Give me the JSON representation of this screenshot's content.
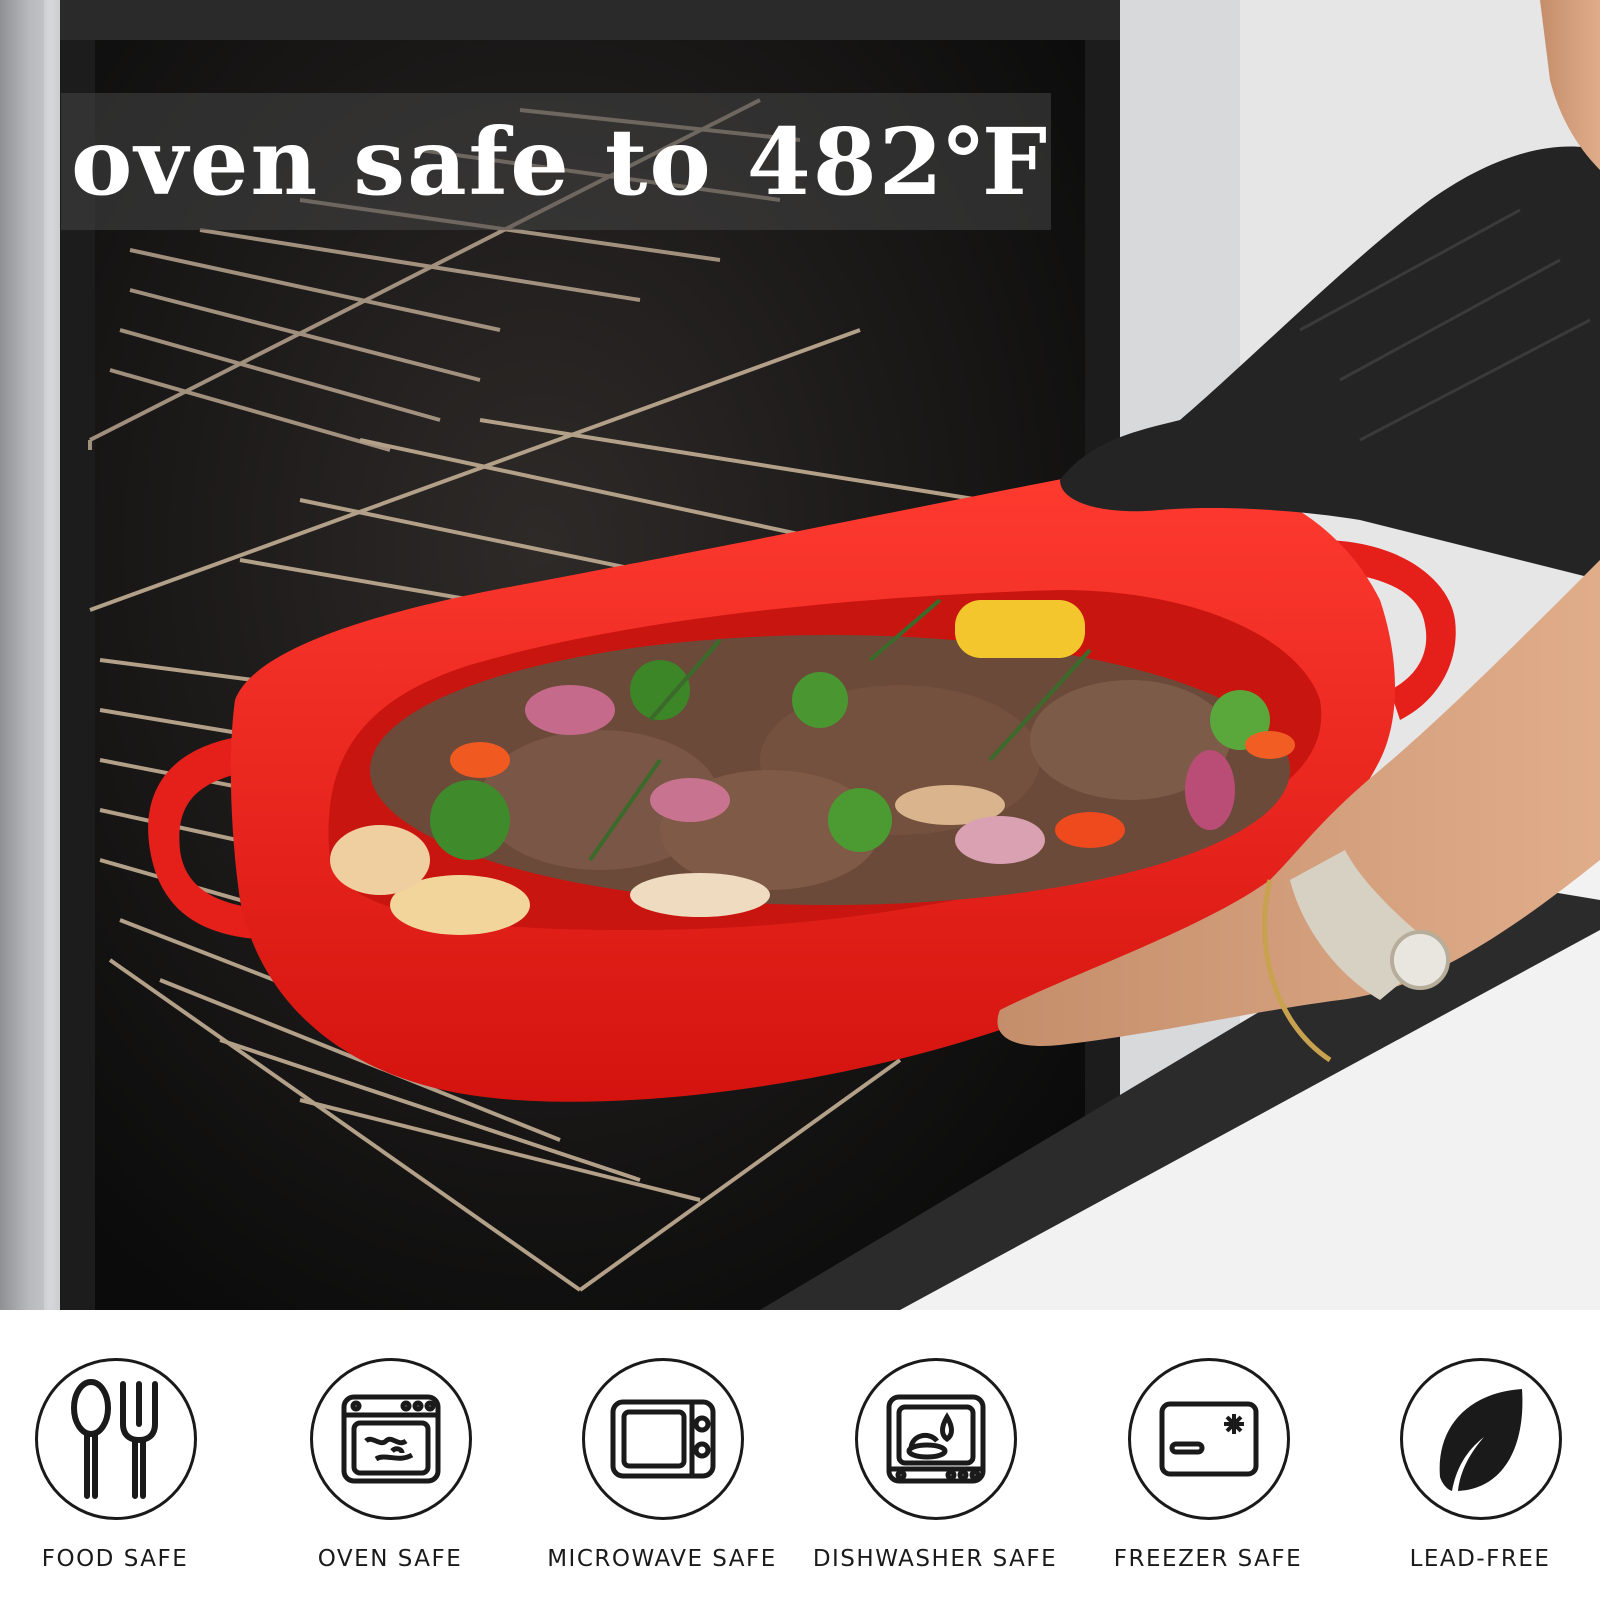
{
  "photo": {
    "description_icon": "oven-photo",
    "colors": {
      "dish_red": "#e8211c",
      "oven_black": "#161616",
      "steel": "#c9ccd0"
    }
  },
  "headline": {
    "text": "oven safe to 482℉"
  },
  "badges": [
    {
      "label": "FOOD SAFE",
      "icon": "spoon-fork-icon"
    },
    {
      "label": "OVEN SAFE",
      "icon": "oven-icon"
    },
    {
      "label": "MICROWAVE SAFE",
      "icon": "microwave-icon"
    },
    {
      "label": "DISHWASHER SAFE",
      "icon": "dishwasher-icon"
    },
    {
      "label": "FREEZER SAFE",
      "icon": "freezer-icon"
    },
    {
      "label": "LEAD-FREE",
      "icon": "leaf-icon"
    }
  ]
}
